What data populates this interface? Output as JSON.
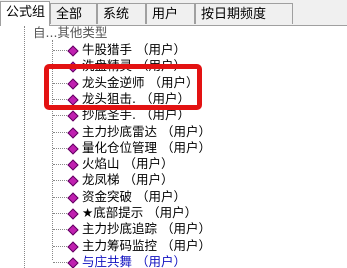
{
  "tabs": [
    {
      "label": "公式组"
    },
    {
      "label": "全部"
    },
    {
      "label": "系统"
    },
    {
      "label": "用户"
    },
    {
      "label": "按日期频度"
    }
  ],
  "tree": {
    "parent_label": "自...其他类型",
    "items": [
      {
        "label": "牛股猎手  （用户）"
      },
      {
        "label": "洗盘精灵  （用户）"
      },
      {
        "label": "龙头金逆师  （用户）"
      },
      {
        "label": "龙头狙击.  （用户）"
      },
      {
        "label": "抄底圣手.  （用户）"
      },
      {
        "label": "主力抄底雷达  （用户）"
      },
      {
        "label": "量化仓位管理  （用户）"
      },
      {
        "label": "火焰山  （用户）"
      },
      {
        "label": "龙凤梯  （用户）"
      },
      {
        "label": "资金突破  （用户）"
      },
      {
        "label": "★底部提示  （用户）"
      },
      {
        "label": "主力抄底追踪  （用户）"
      },
      {
        "label": "主力筹码监控  （用户）"
      },
      {
        "label": "与庄共舞  （用户）"
      }
    ]
  },
  "colors": {
    "highlight": "#e31212",
    "icon": "#c020b0"
  }
}
